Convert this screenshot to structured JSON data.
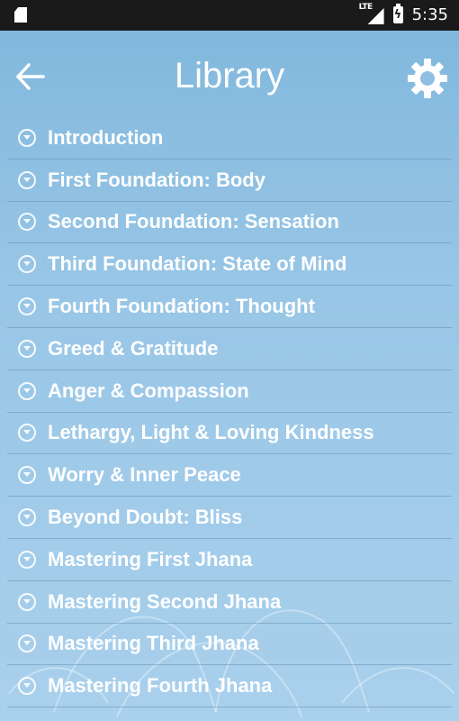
{
  "status_bar": {
    "network": "LTE",
    "time": "5:35",
    "icons": [
      "sd-card-icon",
      "signal-icon",
      "battery-charging-icon"
    ]
  },
  "header": {
    "title": "Library",
    "back_icon": "back-arrow-icon",
    "settings_icon": "gear-icon"
  },
  "library": {
    "items": [
      {
        "label": "Introduction"
      },
      {
        "label": "First Foundation: Body"
      },
      {
        "label": "Second Foundation: Sensation"
      },
      {
        "label": "Third Foundation: State of Mind"
      },
      {
        "label": "Fourth Foundation: Thought"
      },
      {
        "label": "Greed & Gratitude"
      },
      {
        "label": "Anger & Compassion"
      },
      {
        "label": "Lethargy, Light & Loving Kindness"
      },
      {
        "label": "Worry & Inner Peace"
      },
      {
        "label": "Beyond Doubt: Bliss"
      },
      {
        "label": "Mastering First Jhana"
      },
      {
        "label": "Mastering Second Jhana"
      },
      {
        "label": "Mastering Third Jhana"
      },
      {
        "label": "Mastering Fourth Jhana"
      }
    ]
  },
  "colors": {
    "status_bar": "#1a1a1a",
    "background": "#98c6e6",
    "text": "#ffffff"
  }
}
